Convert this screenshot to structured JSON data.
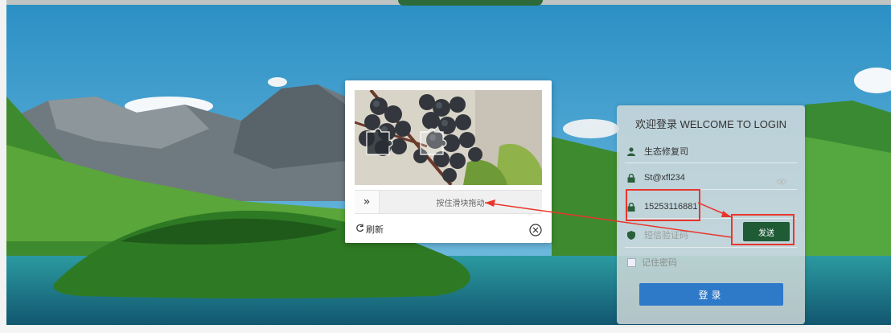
{
  "login": {
    "title": "欢迎登录 WELCOME TO LOGIN",
    "username": "生态修复司",
    "password": "St@xfl234",
    "phone": "15253116881",
    "sms_placeholder": "短信验证码",
    "send_label": "发送",
    "remember_label": "记住密码",
    "login_label": "登录"
  },
  "captcha": {
    "slider_hint": "按住滑块拖动",
    "slider_handle_glyph": "»",
    "refresh_label": "刷新"
  },
  "colors": {
    "send_button": "#1f5b35",
    "login_button": "#2f79c9",
    "annotation": "#e8362d"
  },
  "icons": [
    "user-icon",
    "lock-icon",
    "shield-icon",
    "eye-icon",
    "refresh-icon",
    "close-icon"
  ]
}
